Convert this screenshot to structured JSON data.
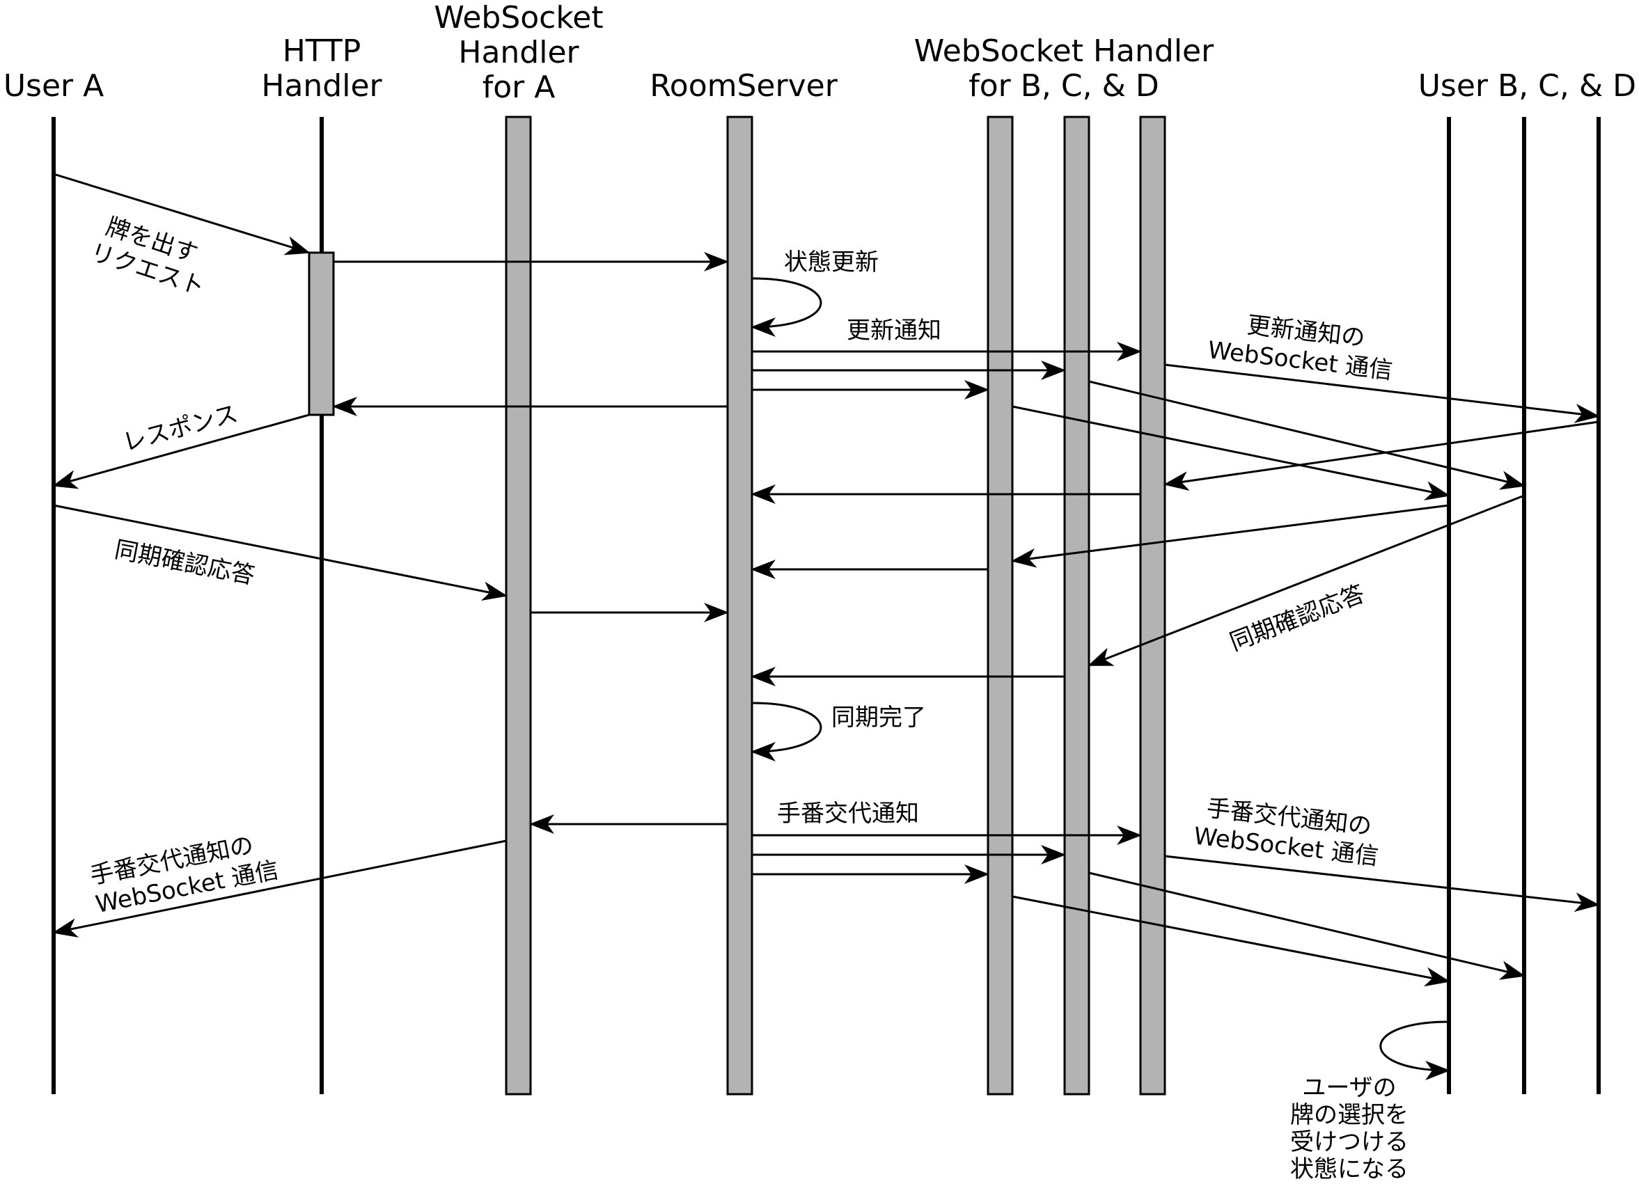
{
  "participants": {
    "user_a": [
      "User A"
    ],
    "http_handler": [
      "HTTP",
      "Handler"
    ],
    "ws_handler_a": [
      "WebSocket",
      "Handler",
      "for A"
    ],
    "room_server": [
      "RoomServer"
    ],
    "ws_handler_bcd": [
      "WebSocket Handler",
      "for B, C, & D"
    ],
    "user_bcd": [
      "User B, C, & D"
    ]
  },
  "messages": {
    "play_request": [
      "牌を出す",
      "リクエスト"
    ],
    "state_update": "状態更新",
    "update_notice": "更新通知",
    "update_notice_ws": [
      "更新通知の",
      "WebSocket 通信"
    ],
    "response": "レスポンス",
    "sync_ack_a": "同期確認応答",
    "sync_ack_bcd": "同期確認応答",
    "sync_complete": "同期完了",
    "turn_change": "手番交代通知",
    "turn_change_ws_bcd": [
      "手番交代通知の",
      "WebSocket 通信"
    ],
    "turn_change_ws_a": [
      "手番交代通知の",
      "WebSocket 通信"
    ],
    "tile_selection_state": [
      "ユーザの",
      "牌の選択を",
      "受けつける",
      "状態になる"
    ]
  }
}
